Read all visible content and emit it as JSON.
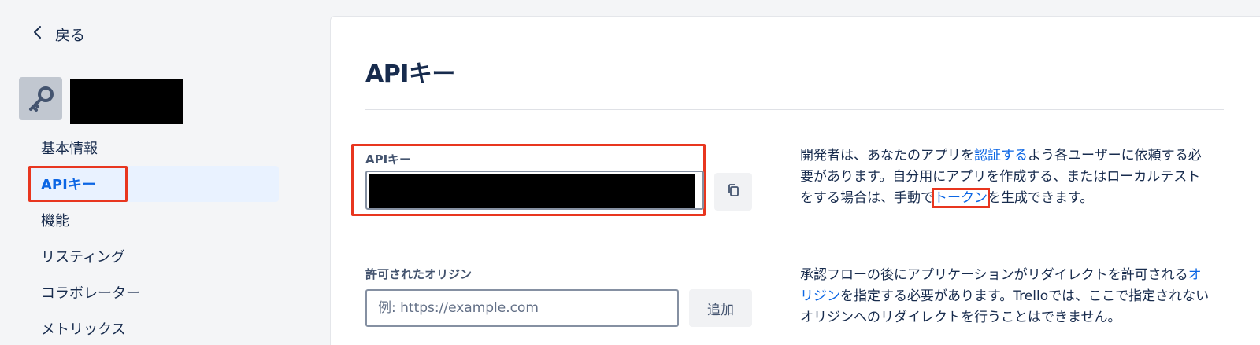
{
  "sidebar": {
    "back_label": "戻る",
    "nav": [
      {
        "label": "基本情報",
        "active": false
      },
      {
        "label": "APIキー",
        "active": true
      },
      {
        "label": "機能",
        "active": false
      },
      {
        "label": "リスティング",
        "active": false
      },
      {
        "label": "コラボレーター",
        "active": false
      },
      {
        "label": "メトリックス",
        "active": false
      }
    ]
  },
  "main": {
    "title": "APIキー",
    "api_key": {
      "label": "APIキー",
      "description": {
        "part1": "開発者は、あなたのアプリを",
        "link_auth": "認証する",
        "part2": "よう各ユーザーに依頼する必要があります。自分用にアプリを作成する、またはローカルテストをする場合は、手動で",
        "link_token": "トークン",
        "part3": "を生成できます。"
      }
    },
    "origins": {
      "label": "許可されたオリジン",
      "placeholder": "例: https://example.com",
      "add_label": "追加",
      "description": {
        "part1": "承認フローの後にアプリケーションがリダイレクトを許可される",
        "link_origin": "オリジン",
        "part2": "を指定する必要があります。Trelloでは、ここで指定されないオリジンへのリダイレクトを行うことはできません。"
      }
    }
  },
  "colors": {
    "accent": "#0c66e4",
    "highlight": "#e8361f",
    "text": "#172b4d"
  }
}
